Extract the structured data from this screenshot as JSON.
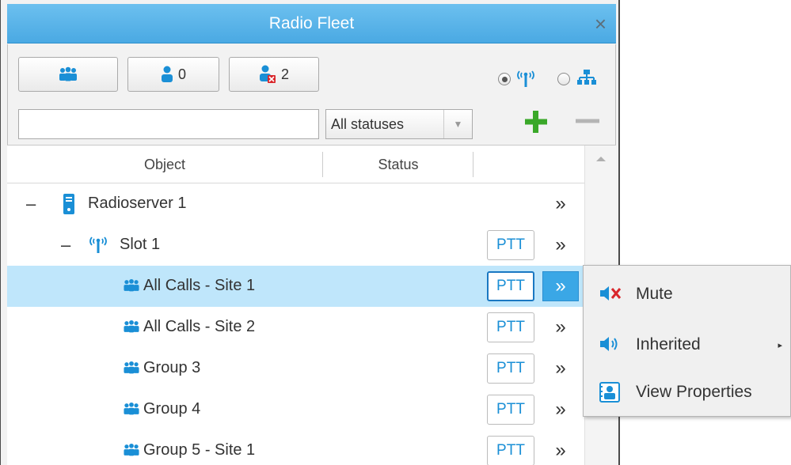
{
  "window": {
    "title": "Radio Fleet",
    "close_symbol": "×"
  },
  "toolbar": {
    "groups_button": {
      "icon": "group-icon"
    },
    "users_button": {
      "icon": "user-icon",
      "count": "0"
    },
    "offline_users_button": {
      "icon": "user-offline-icon",
      "count": "2"
    },
    "view_mode": {
      "options": [
        "radio-view-icon",
        "hierarchy-view-icon"
      ],
      "selected": "radio-view-icon"
    }
  },
  "filter": {
    "search_value": "",
    "status_select": {
      "value": "All statuses"
    },
    "add_icon": "plus-icon",
    "remove_icon": "minus-icon"
  },
  "columns": {
    "object": "Object",
    "status": "Status"
  },
  "tree": {
    "rows": [
      {
        "label": "Radioserver 1",
        "icon": "server-icon",
        "expander": "–",
        "ptt": "",
        "more": "»"
      },
      {
        "label": "Slot 1",
        "icon": "radio-slot-icon",
        "expander": "–",
        "ptt": "PTT",
        "more": "»"
      },
      {
        "label": "All Calls - Site 1",
        "icon": "group-icon",
        "expander": "",
        "ptt": "PTT",
        "more": "»",
        "selected": true
      },
      {
        "label": "All Calls - Site 2",
        "icon": "group-icon",
        "expander": "",
        "ptt": "PTT",
        "more": "»"
      },
      {
        "label": "Group 3",
        "icon": "group-icon",
        "expander": "",
        "ptt": "PTT",
        "more": "»"
      },
      {
        "label": "Group 4",
        "icon": "group-icon",
        "expander": "",
        "ptt": "PTT",
        "more": "»"
      },
      {
        "label": "Group 5 - Site 1",
        "icon": "group-icon",
        "expander": "",
        "ptt": "PTT",
        "more": "»"
      }
    ]
  },
  "context_menu": {
    "items": [
      {
        "label": "Mute",
        "icon": "mute-icon"
      },
      {
        "label": "Inherited",
        "icon": "speaker-icon",
        "submenu": "▸"
      },
      {
        "label": "View Properties",
        "icon": "properties-icon"
      }
    ]
  },
  "colors": {
    "accent": "#4aa9e3",
    "selection": "#bfe6fb",
    "ptt_text": "#1a8fd6",
    "add_green": "#3aa829",
    "mute_red": "#d9262b"
  }
}
